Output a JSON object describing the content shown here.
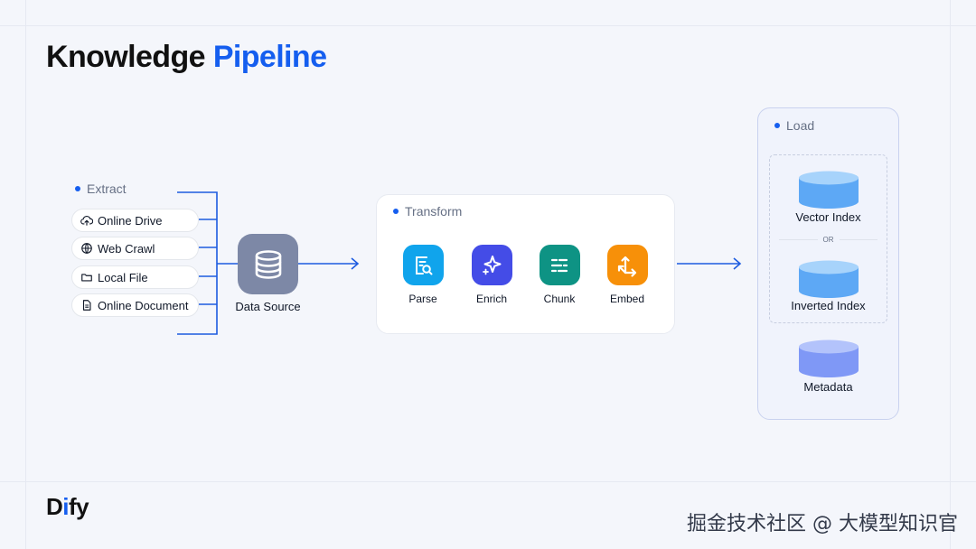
{
  "title": {
    "part1": "Knowledge",
    "part2": "Pipeline"
  },
  "extract": {
    "label": "Extract",
    "sources": [
      {
        "label": "Online Drive",
        "icon": "cloud-upload-icon"
      },
      {
        "label": "Web Crawl",
        "icon": "globe-icon"
      },
      {
        "label": "Local File",
        "icon": "folder-icon"
      },
      {
        "label": "Online Document",
        "icon": "document-icon"
      }
    ]
  },
  "data_source": {
    "label": "Data Source",
    "icon": "database-icon"
  },
  "transform": {
    "label": "Transform",
    "steps": [
      {
        "label": "Parse",
        "icon": "parse-icon",
        "color": "#10a4ec"
      },
      {
        "label": "Enrich",
        "icon": "sparkle-icon",
        "color": "#444ce7"
      },
      {
        "label": "Chunk",
        "icon": "chunk-icon",
        "color": "#0e9384"
      },
      {
        "label": "Embed",
        "icon": "embed-icon",
        "color": "#f79009"
      }
    ]
  },
  "load": {
    "label": "Load",
    "stores": [
      {
        "label": "Vector Index"
      },
      {
        "label": "Inverted Index"
      },
      {
        "label": "Metadata"
      }
    ],
    "or_label": "OR"
  },
  "footer": {
    "brand_d": "D",
    "brand_i": "i",
    "brand_fy": "fy",
    "watermark": "掘金技术社区 @ 大模型知识官"
  },
  "colors": {
    "accent": "#155eef",
    "connector": "#1d5ce0",
    "cylinder": "#6eb4f6",
    "cylinder_alt": "#8ea8f8"
  }
}
